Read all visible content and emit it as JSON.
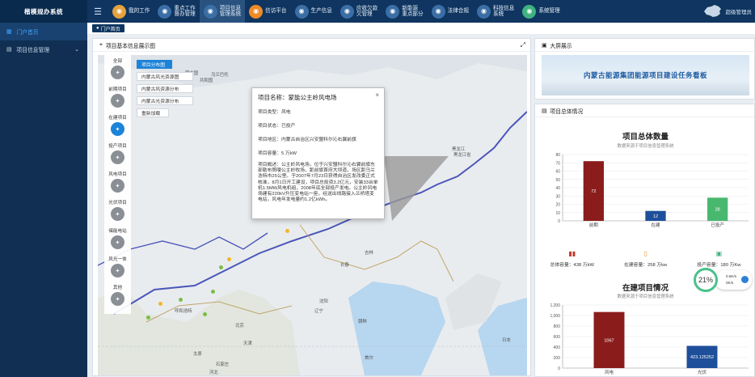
{
  "app": {
    "title": "楷模规办系统",
    "user": "超级管理员"
  },
  "nav": [
    {
      "label": "我的工作",
      "icon": "work-icon",
      "color": "#e6a23c"
    },
    {
      "label": "重点工作\n督办管理",
      "icon": "task-icon",
      "color": "#3b6ea5"
    },
    {
      "label": "项目信息\n管理系统",
      "icon": "project-icon",
      "color": "#3b6ea5",
      "active": true
    },
    {
      "label": "信访平台",
      "icon": "petition-icon",
      "color": "#f08a24"
    },
    {
      "label": "生产信息",
      "icon": "production-icon",
      "color": "#3b6ea5"
    },
    {
      "label": "应收欠款\n欠管理",
      "icon": "receivable-icon",
      "color": "#3b6ea5"
    },
    {
      "label": "新能源\n重点部分",
      "icon": "energy-icon",
      "color": "#3b6ea5"
    },
    {
      "label": "法律合规",
      "icon": "law-icon",
      "color": "#3b6ea5"
    },
    {
      "label": "科技信息\n系统",
      "icon": "tech-icon",
      "color": "#3b6ea5"
    },
    {
      "label": "系统管理",
      "icon": "gear-icon",
      "color": "#3fb27f"
    }
  ],
  "sidebar": [
    {
      "label": "门户首页",
      "icon": "grid-icon",
      "active": true
    },
    {
      "label": "项目信息管理",
      "icon": "list-icon",
      "active": false
    }
  ],
  "tabs": [
    {
      "label": "门户首页"
    }
  ],
  "map_panel": {
    "title": "项目基本信息展示图",
    "legend": [
      {
        "label": "全部",
        "icon": "all-icon"
      },
      {
        "label": "前期项目",
        "icon": "early-icon"
      },
      {
        "label": "在建项目",
        "icon": "building-icon",
        "active": true
      },
      {
        "label": "投产项目",
        "icon": "operating-icon"
      },
      {
        "label": "风电项目",
        "icon": "wind-icon"
      },
      {
        "label": "光伏项目",
        "icon": "solar-icon"
      },
      {
        "label": "储能电站",
        "icon": "storage-icon"
      },
      {
        "label": "风光一体",
        "icon": "hybrid-icon"
      },
      {
        "label": "其他",
        "icon": "other-icon"
      }
    ],
    "layers": [
      "项目分布图",
      "内蒙古风光资源图",
      "内蒙古风资源分布",
      "内蒙古光资源分布",
      "重新加载"
    ],
    "popup": {
      "title": "项目名称：蒙能公主岭风电场",
      "type": "项目类型：风电",
      "status": "项目状态：已投产",
      "region": "项目地区：内蒙古自治区兴安盟科尔沁右翼前旗",
      "capacity": "项目容量：5 万kW",
      "desc": "项目概述：公主岭风电场，位于兴安盟科尔沁右翼前旗东部勒布照嗄公主岭牧场，距前旗首府大坝道，场区距乌兰浩特市25公里。于2007年7月23日获得自治区发改委正式核准，8月1日开工建设，项目总投资3.2亿元，安装33台单机1.5MW风电机组，2008年底全部投产发电。公主岭风电场建有220kV升压变电站一座，经送出线路接入兰桥塔变电站，风电年发电量约1.2亿kWh。"
    },
    "labels": [
      "蒙古国",
      "乌兰巴托",
      "共和国",
      "黑龙江",
      "黑龙江省",
      "长春",
      "吉林",
      "沈阳",
      "辽宁",
      "呼和浩特",
      "北京",
      "天津",
      "太原",
      "石家庄",
      "河北",
      "朝鲜",
      "首尔",
      "日本"
    ]
  },
  "screen_panel": {
    "title": "大屏展示",
    "banner": "内蒙古能源集团能源项目建设任务看板"
  },
  "summary_panel": {
    "title": "项目总体情况",
    "chart1_title": "项目总体数量",
    "chart1_sub": "数据来源于项目信息管理系统",
    "chart2_title": "在建项目情况",
    "chart2_sub": "数据来源于项目信息管理系统",
    "stats": [
      {
        "label": "总体容量：438 万kW",
        "icon": "bar-chart-icon",
        "color": "#c0392b"
      },
      {
        "label": "在建容量：258 万kw",
        "icon": "clipboard-icon",
        "color": "#e6a23c"
      },
      {
        "label": "投产容量：180 万Kw",
        "icon": "check-clipboard-icon",
        "color": "#3fb27f"
      }
    ],
    "ring": "21%",
    "speed": [
      "0.6K/s",
      "0K/s"
    ]
  },
  "chart_data": [
    {
      "type": "bar",
      "title": "项目总体数量",
      "categories": [
        "前期",
        "在建",
        "已投产"
      ],
      "values": [
        72,
        12,
        28
      ],
      "colors": [
        "#8b1c1c",
        "#1e4f9a",
        "#49b86f"
      ],
      "ylim": [
        0,
        80
      ],
      "yticks": [
        0,
        10,
        20,
        30,
        40,
        50,
        60,
        70,
        80
      ]
    },
    {
      "type": "bar",
      "title": "在建项目情况",
      "categories": [
        "风电",
        "光伏"
      ],
      "values": [
        1067,
        423.1252
      ],
      "labels": [
        "1067",
        "423.125252"
      ],
      "colors": [
        "#8b1c1c",
        "#1e4f9a"
      ],
      "ylim": [
        0,
        1200
      ],
      "yticks": [
        0,
        200,
        400,
        600,
        800,
        1000,
        1200
      ]
    }
  ]
}
